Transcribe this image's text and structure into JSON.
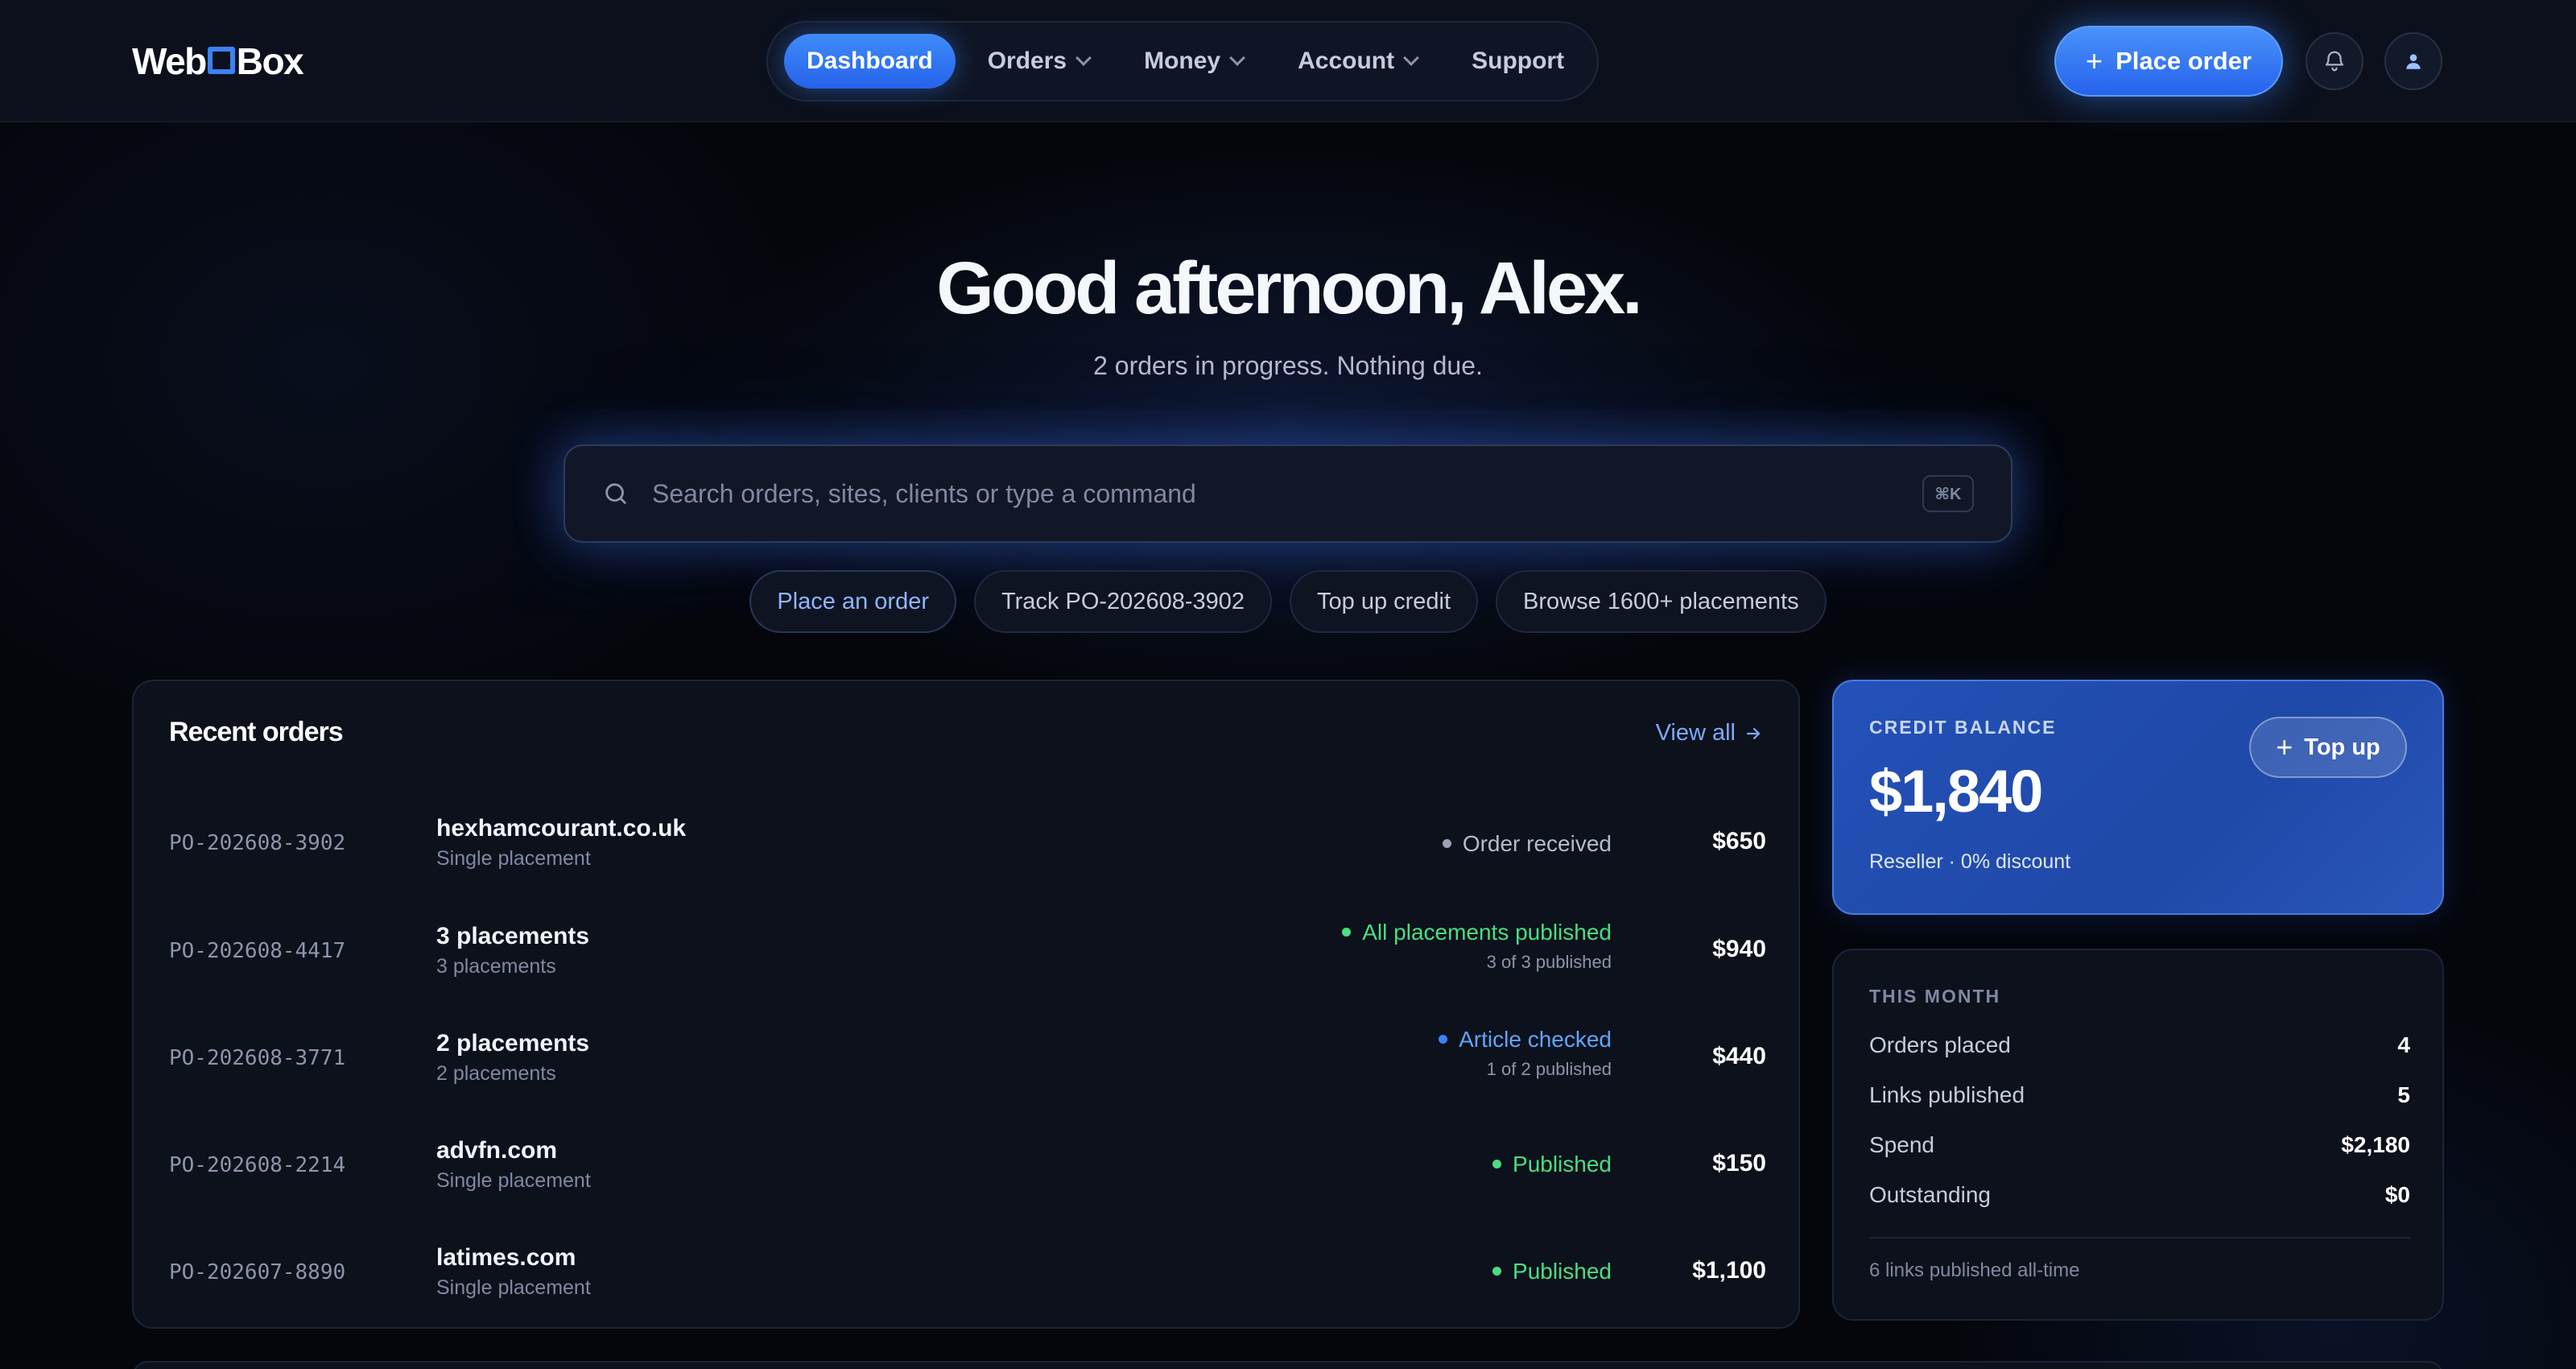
{
  "brand": {
    "logo_left": "Web",
    "logo_right": "Box"
  },
  "nav": {
    "items": [
      {
        "label": "Dashboard",
        "active": true,
        "dropdown": false
      },
      {
        "label": "Orders",
        "active": false,
        "dropdown": true
      },
      {
        "label": "Money",
        "active": false,
        "dropdown": true
      },
      {
        "label": "Account",
        "active": false,
        "dropdown": true
      },
      {
        "label": "Support",
        "active": false,
        "dropdown": false
      }
    ],
    "place_order_label": "Place order"
  },
  "hero": {
    "greeting": "Good afternoon, Alex.",
    "subtitle": "2 orders in progress. Nothing due."
  },
  "search": {
    "placeholder": "Search orders, sites, clients or type a command",
    "shortcut": "⌘K"
  },
  "quick_actions": [
    "Place an order",
    "Track PO-202608-3902",
    "Top up credit",
    "Browse 1600+ placements"
  ],
  "recent_orders": {
    "title": "Recent orders",
    "view_all": "View all",
    "rows": [
      {
        "po": "PO-202608-3902",
        "site": "hexhamcourant.co.uk",
        "sub": "Single placement",
        "status": "Order received",
        "status_detail": "",
        "status_color": "#9aa3b5",
        "amount": "$650"
      },
      {
        "po": "PO-202608-4417",
        "site": "3 placements",
        "sub": "3 placements",
        "status": "All placements published",
        "status_detail": "3 of 3 published",
        "status_color": "#4ade80",
        "amount": "$940"
      },
      {
        "po": "PO-202608-3771",
        "site": "2 placements",
        "sub": "2 placements",
        "status": "Article checked",
        "status_detail": "1 of 2 published",
        "status_color": "#60a5fa",
        "amount": "$440"
      },
      {
        "po": "PO-202608-2214",
        "site": "advfn.com",
        "sub": "Single placement",
        "status": "Published",
        "status_detail": "",
        "status_color": "#4ade80",
        "amount": "$150"
      },
      {
        "po": "PO-202607-8890",
        "site": "latimes.com",
        "sub": "Single placement",
        "status": "Published",
        "status_detail": "",
        "status_color": "#4ade80",
        "amount": "$1,100"
      }
    ]
  },
  "credit": {
    "label": "CREDIT BALANCE",
    "amount": "$1,840",
    "sub": "Reseller · 0% discount",
    "topup_label": "Top up"
  },
  "month": {
    "label": "THIS MONTH",
    "stats": [
      {
        "k": "Orders placed",
        "v": "4"
      },
      {
        "k": "Links published",
        "v": "5"
      },
      {
        "k": "Spend",
        "v": "$2,180"
      },
      {
        "k": "Outstanding",
        "v": "$0"
      }
    ],
    "footer": "6 links published all-time"
  },
  "colors": {
    "accent": "#3b82f6",
    "background": "#04060b",
    "card": "#0c111c",
    "success": "#4ade80"
  },
  "icons": {
    "search": "search-icon",
    "bell": "bell-icon",
    "user": "user-icon",
    "arrow": "arrow-right-icon",
    "plus": "plus-icon",
    "chevron": "chevron-down-icon"
  }
}
